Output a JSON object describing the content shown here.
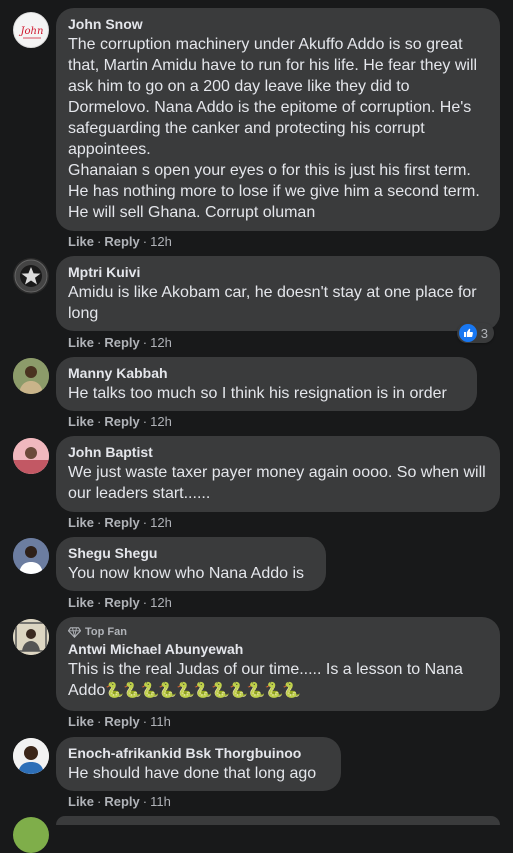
{
  "comments": [
    {
      "author": "John Snow",
      "text": "The corruption machinery under Akuffo Addo is so great that, Martin Amidu have to run for his life. He fear they will ask him to go on a 200 day leave like they did to Dormelovo. Nana Addo is the epitome of corruption. He's safeguarding the canker and protecting his corrupt appointees.\nGhanaian s open your eyes o for this is just his first term. He has nothing more to lose if we give him a second term. He will sell Ghana. Corrupt oluman",
      "like": "Like",
      "reply": "Reply",
      "time": "12h",
      "avatar_text": "John"
    },
    {
      "author": "Mptri Kuivi",
      "text": "Amidu is like Akobam car, he doesn't stay at one place for long",
      "like": "Like",
      "reply": "Reply",
      "time": "12h",
      "reaction_count": "3"
    },
    {
      "author": "Manny Kabbah",
      "text": "He talks too much so I think his resignation is in order",
      "like": "Like",
      "reply": "Reply",
      "time": "12h"
    },
    {
      "author": "John Baptist",
      "text": "We just waste taxer payer money again oooo. So when will our leaders start......",
      "like": "Like",
      "reply": "Reply",
      "time": "12h"
    },
    {
      "author": "Shegu Shegu",
      "text": "You now know who Nana Addo is",
      "like": "Like",
      "reply": "Reply",
      "time": "12h"
    },
    {
      "badge": "Top Fan",
      "author": "Antwi Michael Abunyewah",
      "text": "This is the real Judas of our time..... Is a lesson to Nana Addo",
      "emoji": "🐍🐍🐍🐍🐍🐍🐍🐍🐍🐍🐍",
      "like": "Like",
      "reply": "Reply",
      "time": "11h"
    },
    {
      "author": "Enoch-afrikankid Bsk Thorgbuinoo",
      "text": "He should have done that long ago",
      "like": "Like",
      "reply": "Reply",
      "time": "11h"
    }
  ],
  "sep": "·",
  "colors": {
    "background": "#18191a",
    "bubble": "#3a3b3c",
    "text": "#e4e6eb",
    "secondary": "#b0b3b8",
    "like_blue": "#1877f2"
  }
}
